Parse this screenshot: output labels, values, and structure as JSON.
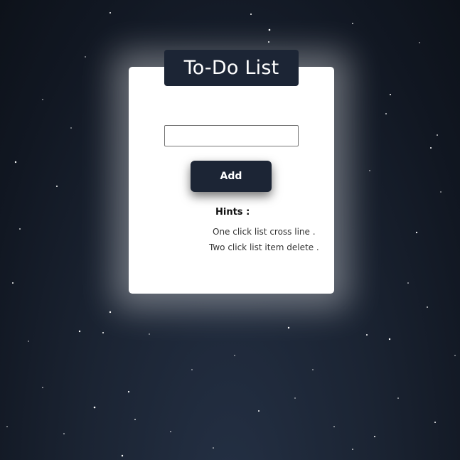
{
  "app": {
    "title": "To-Do List"
  },
  "form": {
    "input_value": "",
    "input_placeholder": "",
    "add_button_label": "Add"
  },
  "hints": {
    "title": "Hints :",
    "lines": [
      "One click list cross line .",
      "Two click list item delete ."
    ]
  },
  "colors": {
    "background": "#1b2433",
    "card": "#ffffff",
    "title_bar": "#1c2535",
    "button": "#1c2535"
  }
}
